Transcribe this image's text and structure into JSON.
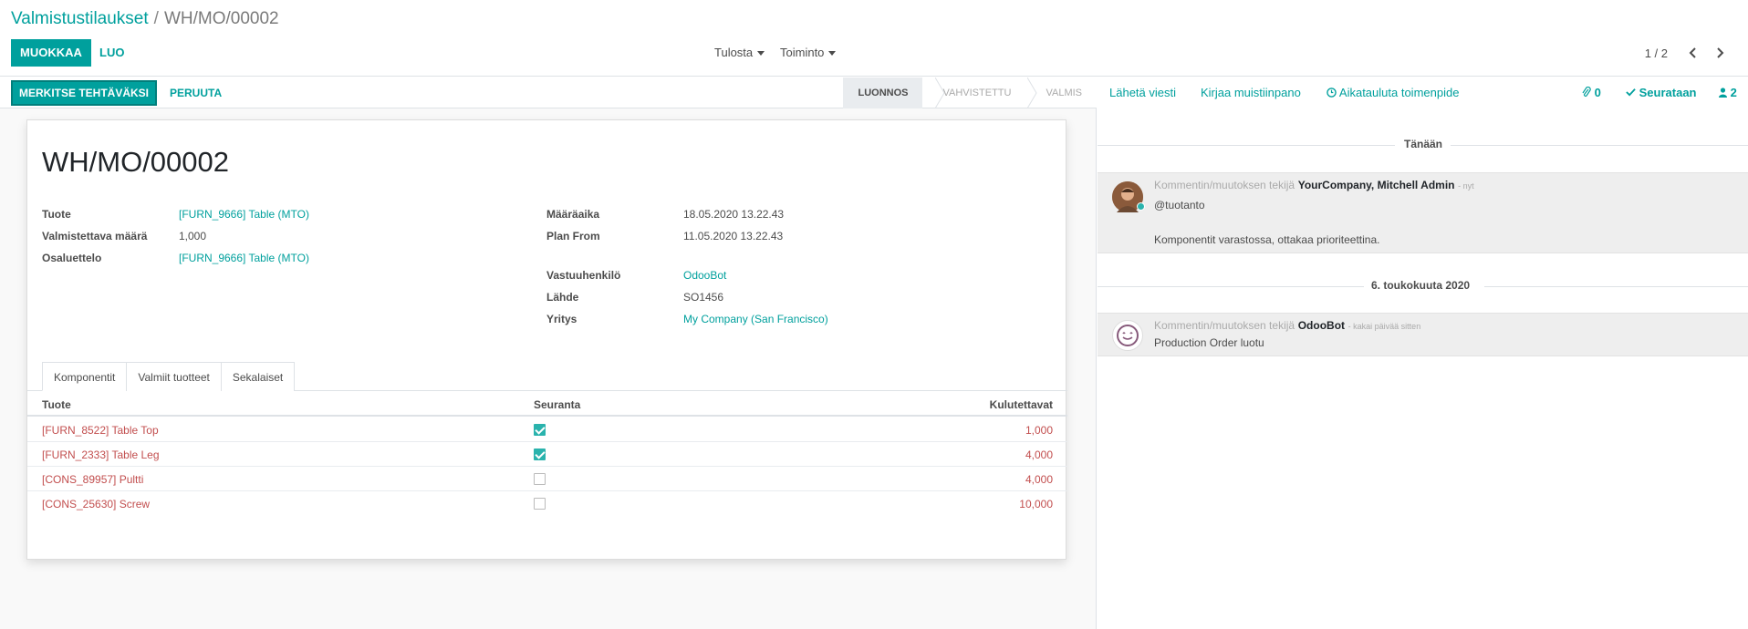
{
  "breadcrumb": {
    "parent": "Valmistustilaukset",
    "separator": "/",
    "current": "WH/MO/00002"
  },
  "toolbar": {
    "edit_label": "MUOKKAA",
    "create_label": "LUO",
    "print_label": "Tulosta",
    "action_label": "Toiminto",
    "pager": "1 / 2"
  },
  "statusbar": {
    "mark_todo": "MERKITSE TEHTÄVÄKSI",
    "cancel": "PERUUTA",
    "stages": [
      "LUONNOS",
      "VAHVISTETTU",
      "VALMIS"
    ],
    "active_stage": "LUONNOS"
  },
  "record": {
    "name": "WH/MO/00002",
    "left_fields": [
      {
        "label": "Tuote",
        "value": "[FURN_9666] Table (MTO)"
      },
      {
        "label": "Valmistettava määrä",
        "value": "1,000"
      },
      {
        "label": "Osaluettelo",
        "value": "[FURN_9666] Table (MTO)"
      }
    ],
    "right_fields": [
      {
        "label": "Määräaika",
        "value": "18.05.2020 13.22.43"
      },
      {
        "label": "Plan From",
        "value": "11.05.2020 13.22.43"
      },
      {
        "label": "Vastuuhenkilö",
        "value": "OdooBot"
      },
      {
        "label": "Lähde",
        "value": "SO1456"
      },
      {
        "label": "Yritys",
        "value": "My Company (San Francisco)"
      }
    ]
  },
  "tabs": [
    "Komponentit",
    "Valmiit tuotteet",
    "Sekalaiset"
  ],
  "table": {
    "headers": [
      "Tuote",
      "Seuranta",
      "Kulutettavat"
    ],
    "rows": [
      {
        "product": "[FURN_8522] Table Top",
        "tracked": true,
        "qty": "1,000"
      },
      {
        "product": "[FURN_2333] Table Leg",
        "tracked": true,
        "qty": "4,000"
      },
      {
        "product": "[CONS_89957] Pultti",
        "tracked": false,
        "qty": "4,000"
      },
      {
        "product": "[CONS_25630] Screw",
        "tracked": false,
        "qty": "10,000"
      }
    ]
  },
  "chatter": {
    "send_message": "Lähetä viesti",
    "log_note": "Kirjaa muistiinpano",
    "schedule": "Aikatauluta toimenpide",
    "attachments": "0",
    "following": "Seurataan",
    "followers": "2",
    "sep_today": "Tänään",
    "sep_date": "6. toukokuuta 2020",
    "messages": [
      {
        "prefix": "Kommentin/muutoksen tekijä",
        "author": "YourCompany, Mitchell Admin",
        "when": "- nyt",
        "line1": "@tuotanto",
        "line2": "Komponentit varastossa, ottakaa prioriteettina."
      },
      {
        "prefix": "Kommentin/muutoksen tekijä",
        "author": "OdooBot",
        "when": "- kakai päivää sitten",
        "line1": "Production Order luotu"
      }
    ]
  },
  "colors": {
    "primary": "#00a09d",
    "link_red": "#c24e4e",
    "check": "#2ab3ad"
  }
}
